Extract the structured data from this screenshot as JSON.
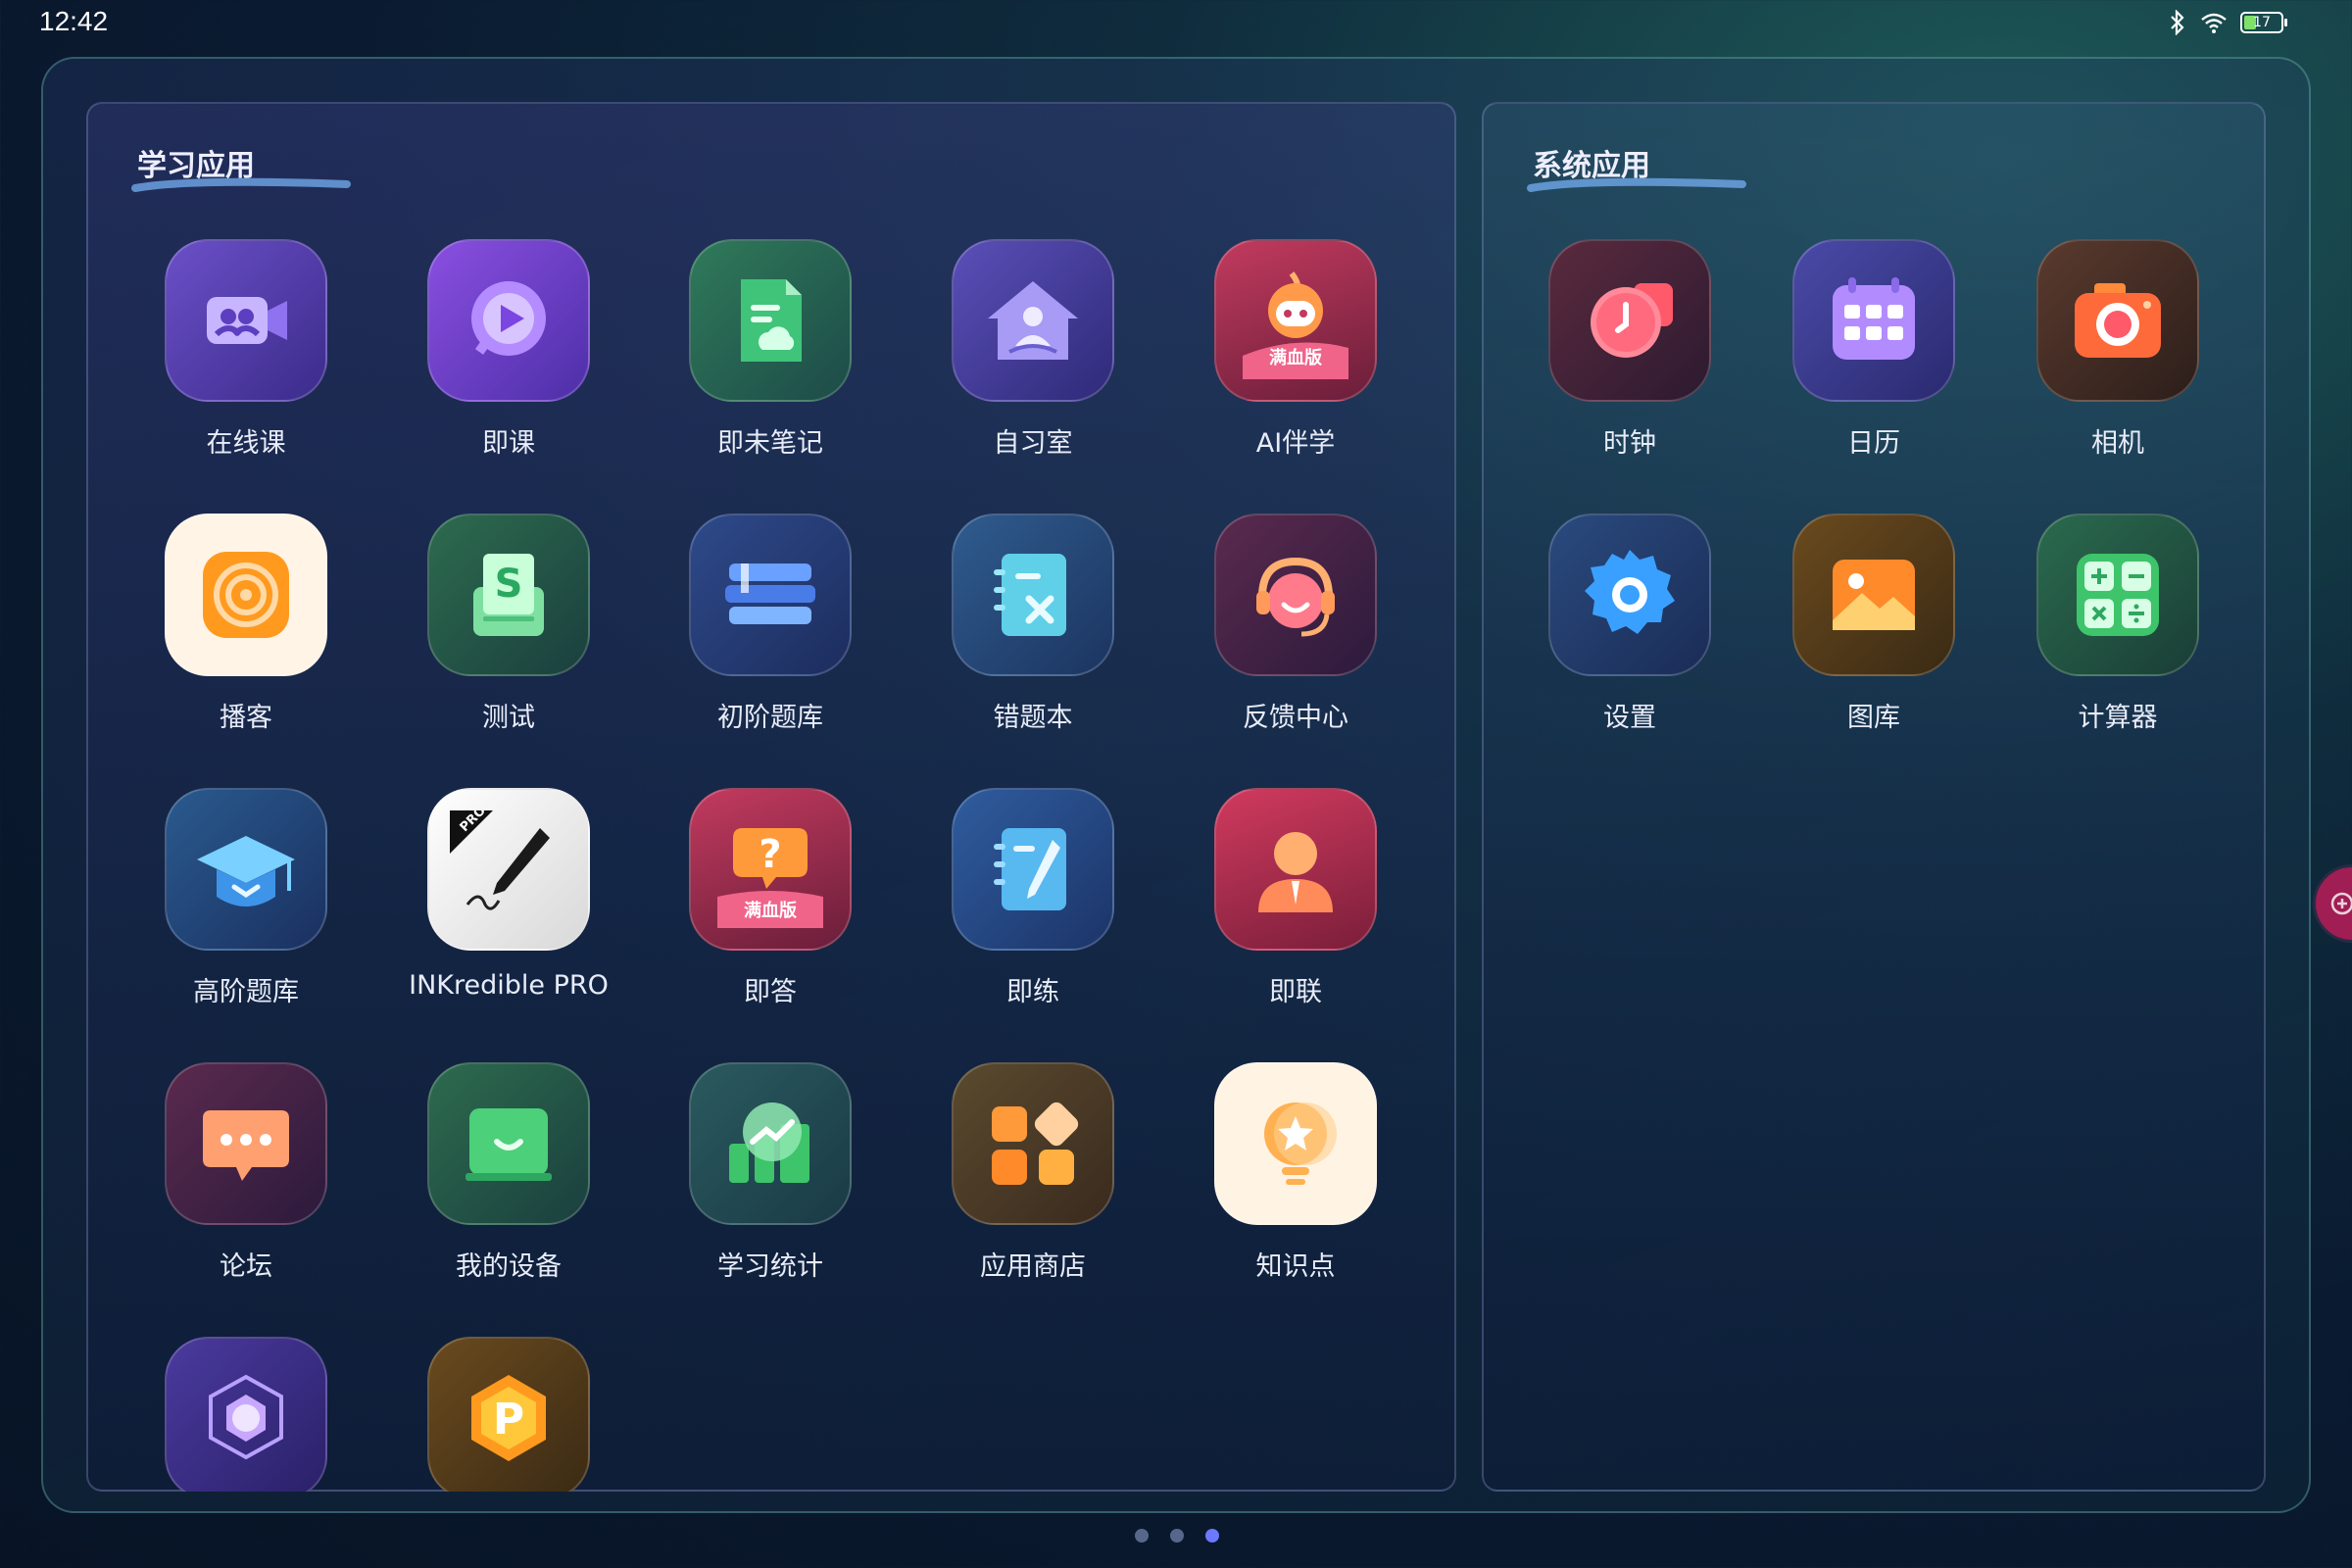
{
  "status": {
    "time": "12:42",
    "battery": "17"
  },
  "learning": {
    "title": "学习应用",
    "apps": [
      {
        "label": "在线课"
      },
      {
        "label": "即课"
      },
      {
        "label": "即未笔记"
      },
      {
        "label": "自习室"
      },
      {
        "label": "AI伴学",
        "badge": "满血版"
      },
      {
        "label": "播客"
      },
      {
        "label": "测试"
      },
      {
        "label": "初阶题库"
      },
      {
        "label": "错题本"
      },
      {
        "label": "反馈中心"
      },
      {
        "label": "高阶题库"
      },
      {
        "label": "INKredible PRO",
        "badge": "PRO"
      },
      {
        "label": "即答",
        "badge": "满血版"
      },
      {
        "label": "即练"
      },
      {
        "label": "即联"
      },
      {
        "label": "论坛"
      },
      {
        "label": "我的设备"
      },
      {
        "label": "学习统计"
      },
      {
        "label": "应用商店"
      },
      {
        "label": "知识点"
      },
      {
        "label": ""
      },
      {
        "label": "",
        "glyph": "P"
      }
    ]
  },
  "system": {
    "title": "系统应用",
    "apps": [
      {
        "label": "时钟"
      },
      {
        "label": "日历"
      },
      {
        "label": "相机"
      },
      {
        "label": "设置"
      },
      {
        "label": "图库"
      },
      {
        "label": "计算器"
      }
    ]
  },
  "pager": {
    "pages": 3,
    "current": 3
  }
}
